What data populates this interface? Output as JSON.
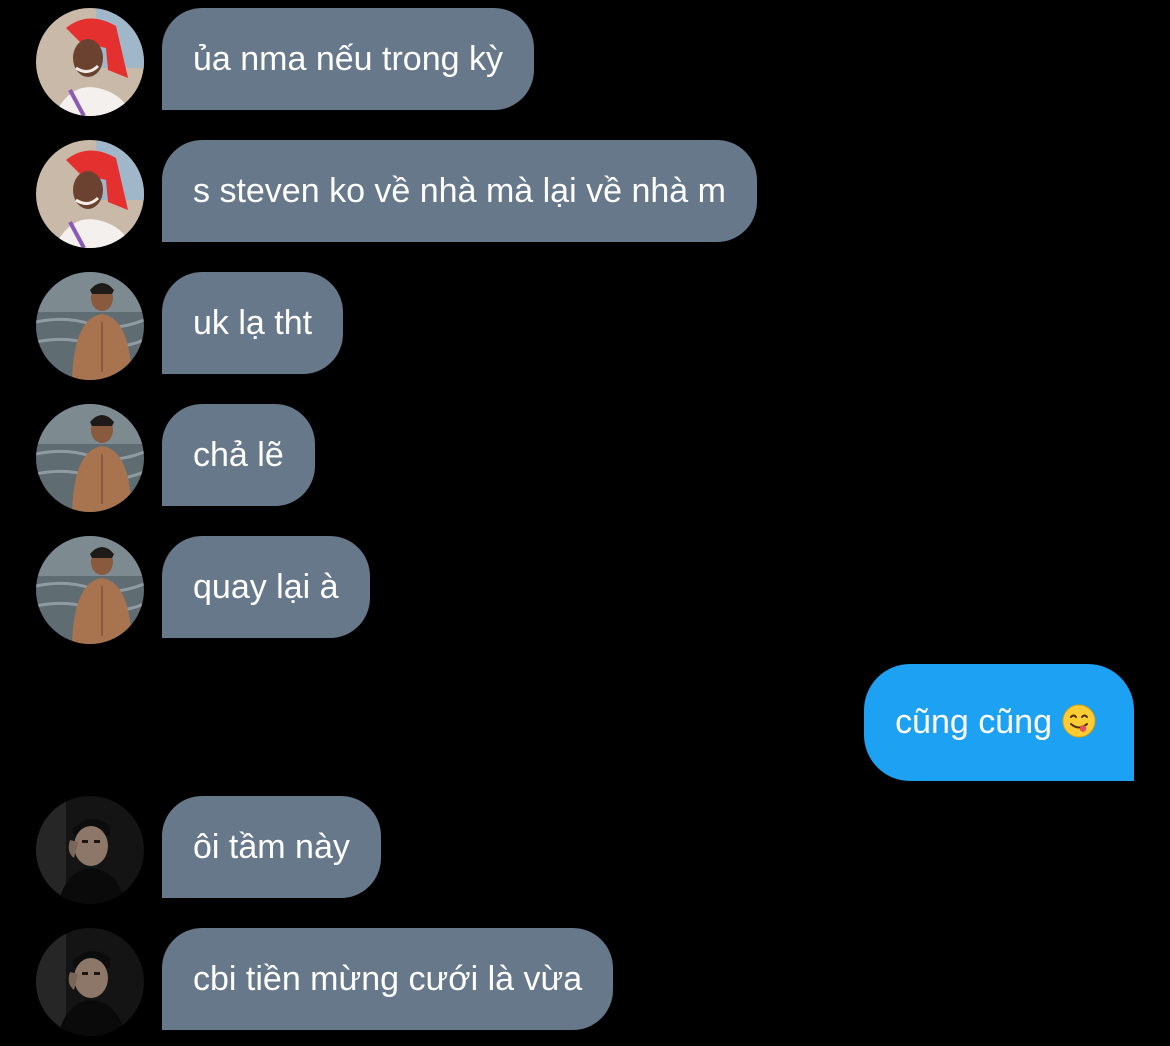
{
  "messages": [
    {
      "sender": "user-a",
      "text": "ủa nma nếu trong kỳ"
    },
    {
      "sender": "user-a",
      "text": "s steven ko về nhà mà lại về nhà m"
    },
    {
      "sender": "user-b",
      "text": "uk lạ tht"
    },
    {
      "sender": "user-b",
      "text": "chả lẽ"
    },
    {
      "sender": "user-b",
      "text": "quay lại à"
    },
    {
      "sender": "me",
      "text": "cũng cũng",
      "emoji": "face-savoring-food-emoji"
    },
    {
      "sender": "user-c",
      "text": "ôi tầm này"
    },
    {
      "sender": "user-c",
      "text": "cbi tiền mừng cưới là vừa"
    }
  ],
  "colors": {
    "background": "#000000",
    "received_bubble": "#66788a",
    "sent_bubble": "#1da1f2",
    "text": "#ffffff"
  }
}
